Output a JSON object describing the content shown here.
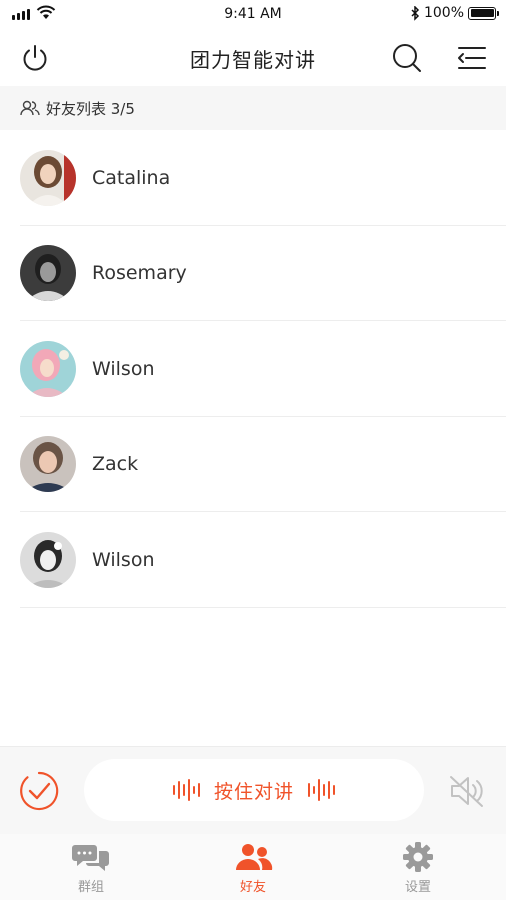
{
  "status_bar": {
    "time": "9:41 AM",
    "battery": "100%"
  },
  "nav": {
    "title": "团力智能对讲"
  },
  "friends_header": {
    "label": "好友列表 3/5"
  },
  "friends": [
    {
      "name": "Catalina"
    },
    {
      "name": "Rosemary"
    },
    {
      "name": "Wilson"
    },
    {
      "name": "Zack"
    },
    {
      "name": "Wilson"
    }
  ],
  "ptt": {
    "label": "按住对讲"
  },
  "tabs": [
    {
      "label": "群组",
      "icon": "chat-bubbles-icon",
      "active": false
    },
    {
      "label": "好友",
      "icon": "people-icon",
      "active": true
    },
    {
      "label": "设置",
      "icon": "gear-icon",
      "active": false
    }
  ],
  "colors": {
    "accent": "#f0532a",
    "inactive": "#999999"
  }
}
